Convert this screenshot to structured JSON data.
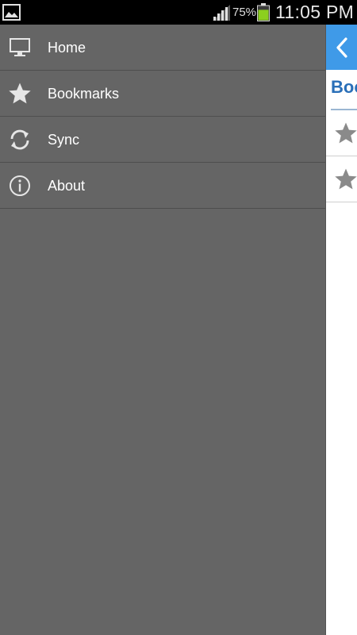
{
  "status_bar": {
    "notification_icon": "image-notification-icon",
    "signal_icon": "signal-icon",
    "battery_percent": "75%",
    "battery_icon": "battery-icon",
    "battery_color": "#8ccf1e",
    "time": "11:05 PM"
  },
  "drawer": {
    "items": [
      {
        "label": "Home",
        "icon": "monitor-icon"
      },
      {
        "label": "Bookmarks",
        "icon": "star-icon"
      },
      {
        "label": "Sync",
        "icon": "sync-icon"
      },
      {
        "label": "About",
        "icon": "info-icon"
      }
    ]
  },
  "content": {
    "back_icon": "chevron-left-icon",
    "accent_color": "#3f9ae8",
    "title": "Bookmarks",
    "rows": [
      {
        "icon": "star-icon"
      },
      {
        "icon": "star-icon"
      }
    ]
  }
}
